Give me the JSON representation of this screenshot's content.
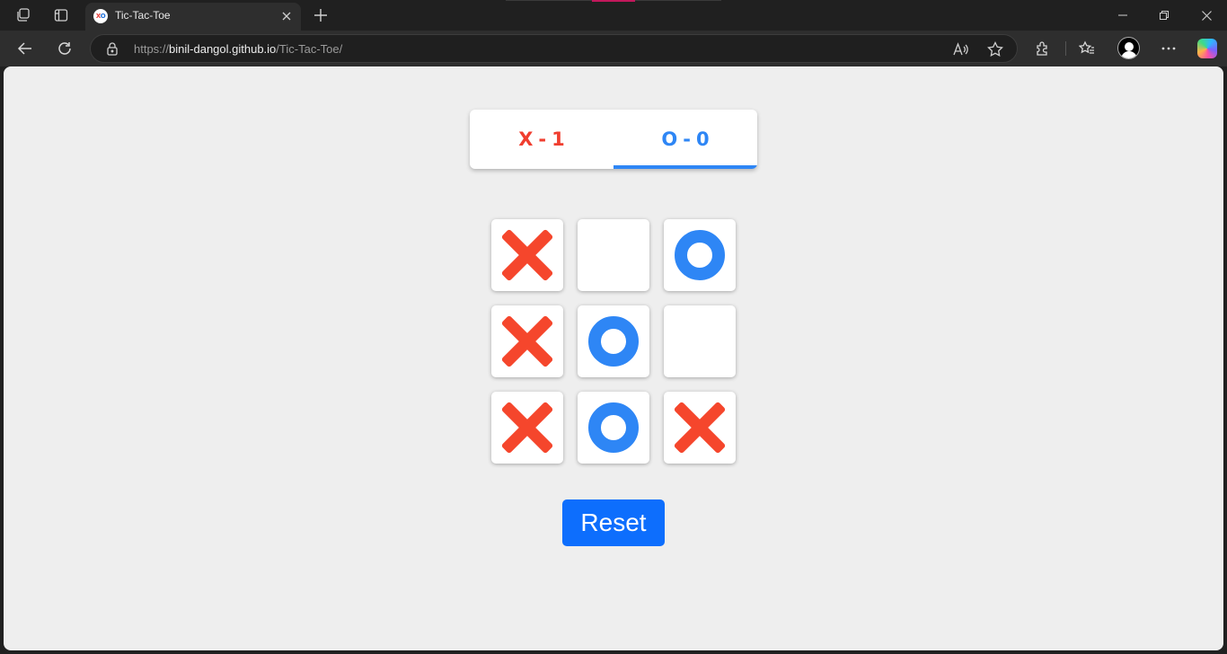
{
  "browser": {
    "tab_title": "Tic-Tac-Toe",
    "favicon_text": {
      "x": "X",
      "o": "O"
    },
    "url_scheme": "https://",
    "url_host": "binil-dangol.github.io",
    "url_path": "/Tic-Tac-Toe/"
  },
  "scoreboard": {
    "x": {
      "symbol": "X",
      "separator": "-",
      "score": "1"
    },
    "o": {
      "symbol": "O",
      "separator": "-",
      "score": "0"
    },
    "current_turn": "O"
  },
  "board": {
    "cells": [
      "X",
      "",
      "O",
      "X",
      "O",
      "",
      "X",
      "O",
      "X"
    ]
  },
  "reset_label": "Reset",
  "colors": {
    "x": "#f5462c",
    "o": "#2e86f5",
    "reset_button": "#0d6efd",
    "page_background": "#eeeeee"
  }
}
